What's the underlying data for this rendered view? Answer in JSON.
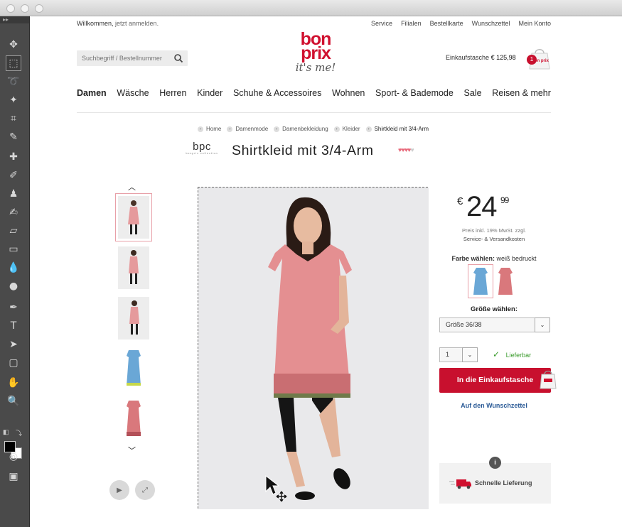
{
  "topbar": {
    "welcome": "Willkommen,",
    "login": "jetzt anmelden.",
    "links": [
      "Service",
      "Filialen",
      "Bestellkarte",
      "Wunschzettel",
      "Mein Konto"
    ]
  },
  "search": {
    "placeholder": "Suchbegriff / Bestellnummer"
  },
  "logo": {
    "line1": "bon",
    "line2": "prix",
    "tagline": "it's me!"
  },
  "cart": {
    "label": "Einkaufstasche",
    "amount": "€ 125,98",
    "count": "1",
    "bag_text": "bon prix"
  },
  "nav": [
    "Damen",
    "Wäsche",
    "Herren",
    "Kinder",
    "Schuhe & Accessoires",
    "Wohnen",
    "Sport- & Bademode",
    "Sale",
    "Reisen & mehr"
  ],
  "breadcrumb": [
    "Home",
    "Damenmode",
    "Damenbekleidung",
    "Kleider",
    "Shirtkleid mit 3/4-Arm"
  ],
  "brand": {
    "name": "bpc",
    "sub": "bonprix collection"
  },
  "product": {
    "title": "Shirtkleid mit 3/4-Arm",
    "rating_filled": 4,
    "rating_max": 5,
    "price_currency": "€",
    "price_euros": "24",
    "price_cents": "99",
    "price_note1": "Preis inkl. 19% MwSt. zzgl.",
    "price_note2": "Service- & Versandkosten",
    "color_label": "Farbe wählen:",
    "color_value": "weiß bedruckt",
    "size_label": "Größe wählen:",
    "size_value": "Größe 36/38",
    "qty_value": "1",
    "availability": "Lieferbar",
    "add_to_cart": "In die Einkaufstasche",
    "wishlist": "Auf den Wunschzettel",
    "delivery_info": "i",
    "delivery": "Schnelle Lieferung"
  },
  "colors": {
    "accent": "#c8102e",
    "link": "#2a5a96",
    "available": "#3a9b2c"
  },
  "gallery": {
    "up": "^",
    "down": "v",
    "play": "play-icon",
    "fullscreen": "expand-icon"
  },
  "toolbar": {
    "header": "▸▸"
  }
}
